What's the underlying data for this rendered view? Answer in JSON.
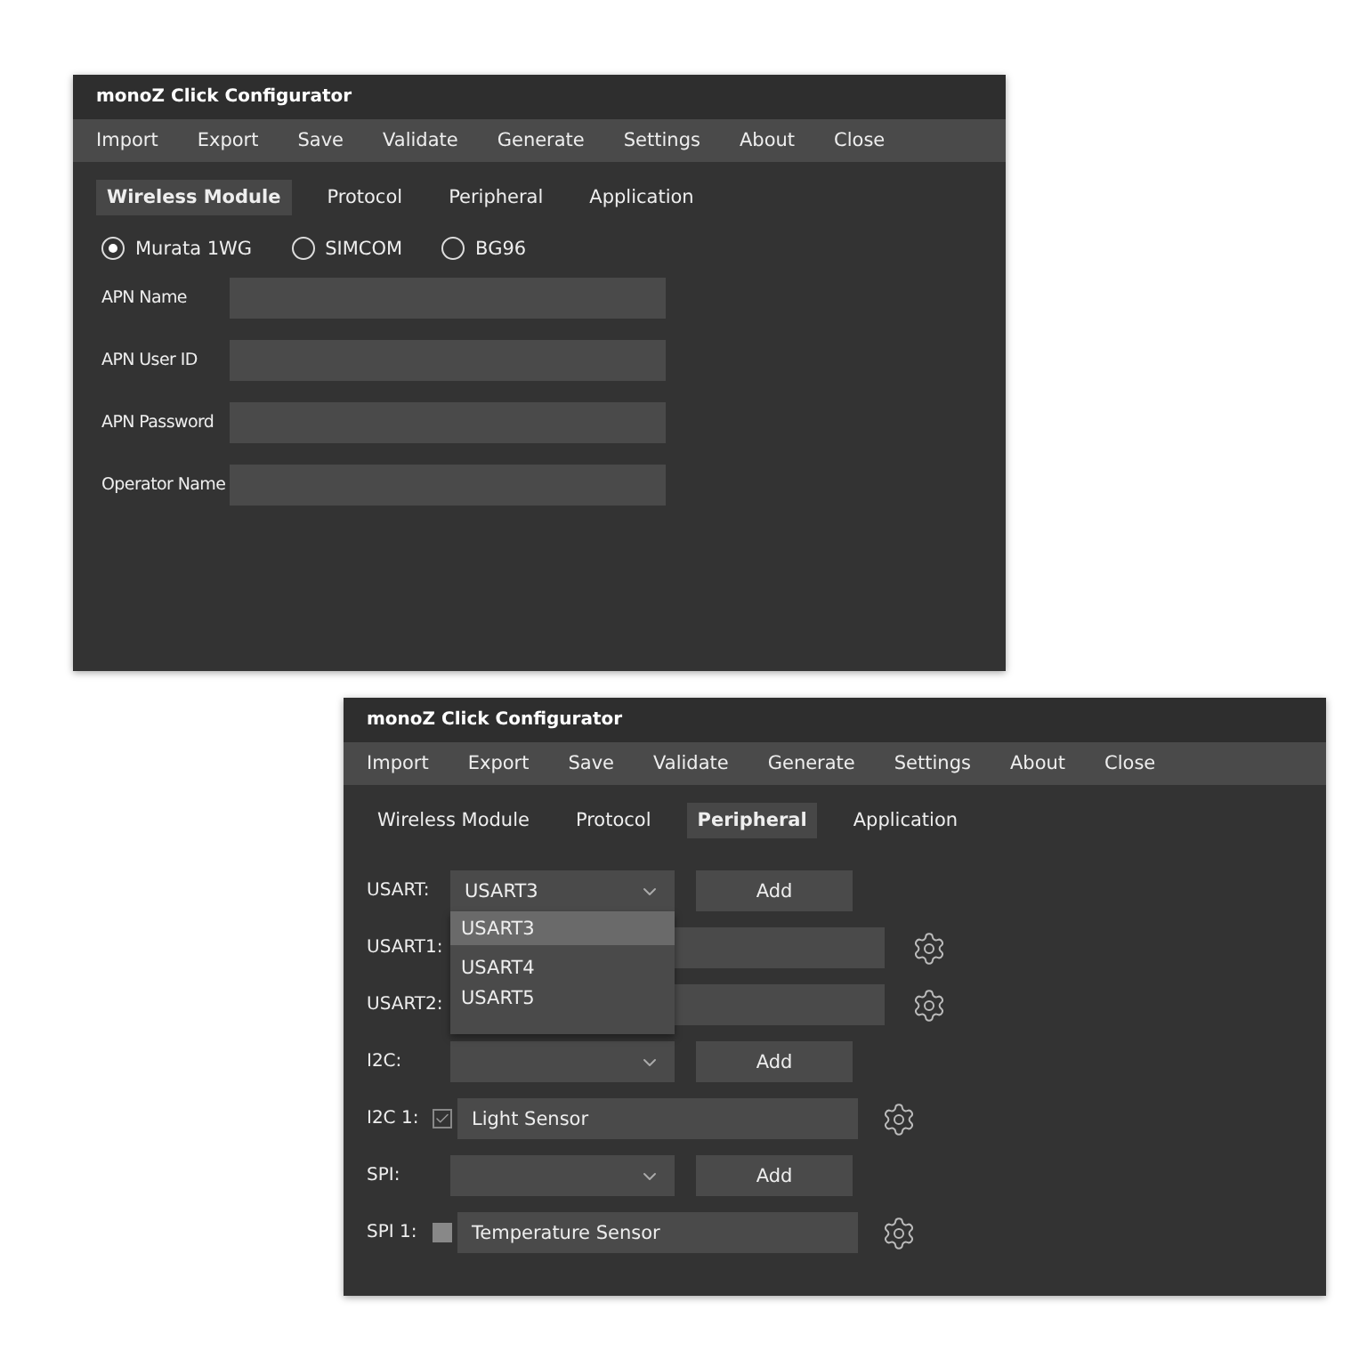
{
  "windows": [
    {
      "title": "monoZ Click Configurator",
      "menu": [
        "Import",
        "Export",
        "Save",
        "Validate",
        "Generate",
        "Settings",
        "About",
        "Close"
      ],
      "tabs": [
        {
          "label": "Wireless Module",
          "selected": true
        },
        {
          "label": "Protocol",
          "selected": false
        },
        {
          "label": "Peripheral",
          "selected": false
        },
        {
          "label": "Application",
          "selected": false
        }
      ],
      "content": {
        "kind": "wireless",
        "radios": [
          {
            "label": "Murata 1WG",
            "selected": true
          },
          {
            "label": "SIMCOM",
            "selected": false
          },
          {
            "label": "BG96",
            "selected": false
          }
        ],
        "fields": [
          {
            "label": "APN Name"
          },
          {
            "label": "APN User ID"
          },
          {
            "label": "APN Password"
          },
          {
            "label": "Operator Name"
          }
        ]
      }
    },
    {
      "title": "monoZ Click Configurator",
      "menu": [
        "Import",
        "Export",
        "Save",
        "Validate",
        "Generate",
        "Settings",
        "About",
        "Close"
      ],
      "tabs": [
        {
          "label": "Wireless Module",
          "selected": false
        },
        {
          "label": "Protocol",
          "selected": false
        },
        {
          "label": "Peripheral",
          "selected": true
        },
        {
          "label": "Application",
          "selected": false
        }
      ],
      "content": {
        "kind": "peripheral",
        "rows": [
          {
            "kind": "select",
            "label": "USART:",
            "value": "USART3",
            "button": "Add",
            "dropdown": [
              {
                "label": "USART3",
                "selected": true
              },
              {
                "label": "USART4",
                "selected": false
              },
              {
                "label": "USART5",
                "selected": false
              }
            ]
          },
          {
            "kind": "entry",
            "label": "USART1:"
          },
          {
            "kind": "entry",
            "label": "USART2:"
          },
          {
            "kind": "select",
            "label": "I2C:",
            "button": "Add"
          },
          {
            "kind": "entry",
            "label": "I2C 1:",
            "checked": true,
            "value": "Light Sensor"
          },
          {
            "kind": "select",
            "label": "SPI:",
            "button": "Add"
          },
          {
            "kind": "entry",
            "label": "SPI 1:",
            "checked": false,
            "value": "Temperature Sensor"
          }
        ]
      }
    }
  ]
}
